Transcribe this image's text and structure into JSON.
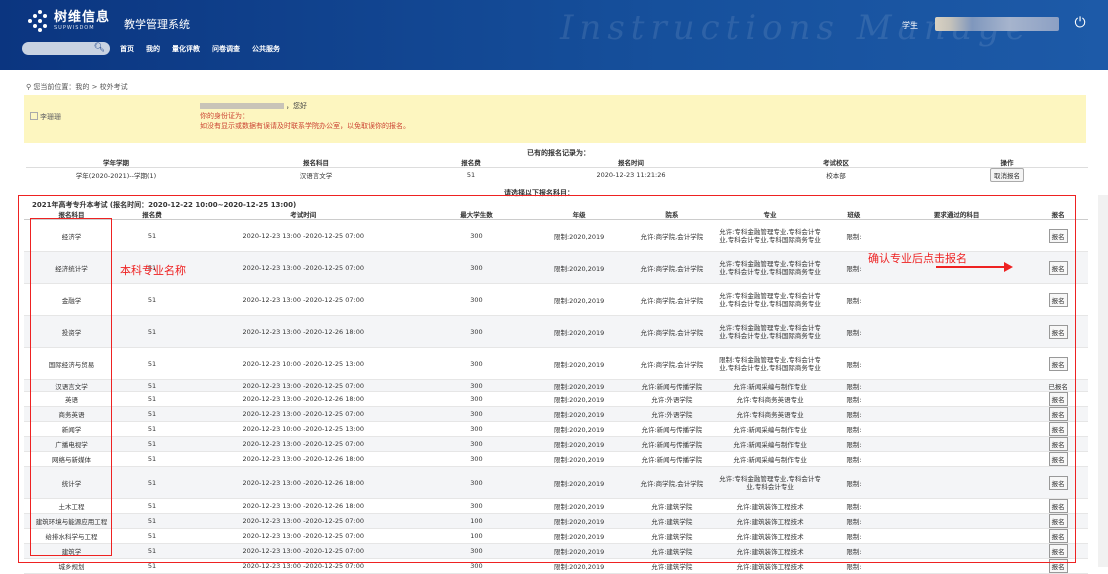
{
  "header": {
    "logo_cn": "树维信息",
    "logo_en": "SUPWISDOM",
    "system_title": "教学管理系统",
    "watermark": "Instructions Manage",
    "student_label": "学生"
  },
  "nav": {
    "items": [
      "首页",
      "我的",
      "量化评教",
      "问卷调查",
      "公共服务"
    ]
  },
  "breadcrumb": "您当前位置：我的 > 校外考试",
  "notice": {
    "image_alt": "李珊珊",
    "greeting": "，您好",
    "identity": "你的身份证为：",
    "hint": "如没有显示或数据有误请及时联系学院办公室，以免取误你的报名。"
  },
  "records": {
    "title": "已有的报名记录为：",
    "headers": [
      "学年学期",
      "报名科目",
      "报名费",
      "报名时间",
      "考试校区",
      "操作"
    ],
    "rows": [
      {
        "term": "学年(2020-2021)--学期(1)",
        "subject": "汉语言文学",
        "fee": "51",
        "time": "2020-12-23 11:21:26",
        "campus": "校本部",
        "action": "取消报名"
      }
    ]
  },
  "select_title": "请选择以下报名科目：",
  "exam": {
    "title": "2021年高考专升本考试 (报名时间：2020-12-22 10:00~2020-12-25 13:00)",
    "headers": [
      "报名科目",
      "报名费",
      "考试时间",
      "最大学生数",
      "年级",
      "院系",
      "专业",
      "班级",
      "要求通过的科目",
      "报名"
    ]
  },
  "rows": [
    {
      "subject": "经济学",
      "fee": "51",
      "time": "2020-12-23 13:00 -2020-12-25 07:00",
      "max": "300",
      "grade": "限制:2020,2019",
      "dept": "允许:商学院,会计学院",
      "major": "允许:专科金融管理专业,专科会计专业,专科会计专业,专科国际商务专业",
      "cls": "限制:",
      "action": "报名"
    },
    {
      "subject": "经济统计学",
      "fee": "51",
      "time": "2020-12-23 13:00 -2020-12-25 07:00",
      "max": "300",
      "grade": "限制:2020,2019",
      "dept": "允许:商学院,会计学院",
      "major": "允许:专科金融管理专业,专科会计专业,专科会计专业,专科国际商务专业",
      "cls": "限制:",
      "action": "报名"
    },
    {
      "subject": "金融学",
      "fee": "51",
      "time": "2020-12-23 13:00 -2020-12-25 07:00",
      "max": "300",
      "grade": "限制:2020,2019",
      "dept": "允许:商学院,会计学院",
      "major": "允许:专科金融管理专业,专科会计专业,专科会计专业,专科国际商务专业",
      "cls": "限制:",
      "action": "报名"
    },
    {
      "subject": "投资学",
      "fee": "51",
      "time": "2020-12-23 13:00 -2020-12-26 18:00",
      "max": "300",
      "grade": "限制:2020,2019",
      "dept": "允许:商学院,会计学院",
      "major": "允许:专科金融管理专业,专科会计专业,专科会计专业,专科国际商务专业",
      "cls": "限制:",
      "action": "报名"
    },
    {
      "subject": "国际经济与贸易",
      "fee": "51",
      "time": "2020-12-23 10:00 -2020-12-25 13:00",
      "max": "300",
      "grade": "限制:2020,2019",
      "dept": "允许:商学院,会计学院",
      "major": "限制:专科金融管理专业,专科会计专业,专科会计专业,专科国际商务专业",
      "cls": "限制:",
      "action": "报名"
    },
    {
      "subject": "汉语言文学",
      "fee": "51",
      "time": "2020-12-23 13:00 -2020-12-25 07:00",
      "max": "300",
      "grade": "限制:2020,2019",
      "dept": "允许:新闻与传播学院",
      "major": "允许:新闻采编与制作专业",
      "cls": "限制:",
      "action": "已报名"
    },
    {
      "subject": "英语",
      "fee": "51",
      "time": "2020-12-23 13:00 -2020-12-26 18:00",
      "max": "300",
      "grade": "限制:2020,2019",
      "dept": "允许:外语学院",
      "major": "允许:专科商务英语专业",
      "cls": "限制:",
      "action": "报名"
    },
    {
      "subject": "商务英语",
      "fee": "51",
      "time": "2020-12-23 13:00 -2020-12-25 07:00",
      "max": "300",
      "grade": "限制:2020,2019",
      "dept": "允许:外语学院",
      "major": "允许:专科商务英语专业",
      "cls": "限制:",
      "action": "报名"
    },
    {
      "subject": "新闻学",
      "fee": "51",
      "time": "2020-12-23 10:00 -2020-12-25 13:00",
      "max": "300",
      "grade": "限制:2020,2019",
      "dept": "允许:新闻与传播学院",
      "major": "允许:新闻采编与制作专业",
      "cls": "限制:",
      "action": "报名"
    },
    {
      "subject": "广播电视学",
      "fee": "51",
      "time": "2020-12-23 13:00 -2020-12-25 07:00",
      "max": "300",
      "grade": "限制:2020,2019",
      "dept": "允许:新闻与传播学院",
      "major": "允许:新闻采编与制作专业",
      "cls": "限制:",
      "action": "报名"
    },
    {
      "subject": "网络与新媒体",
      "fee": "51",
      "time": "2020-12-23 13:00 -2020-12-26 18:00",
      "max": "300",
      "grade": "限制:2020,2019",
      "dept": "允许:新闻与传播学院",
      "major": "允许:新闻采编与制作专业",
      "cls": "限制:",
      "action": "报名"
    },
    {
      "subject": "统计学",
      "fee": "51",
      "time": "2020-12-23 13:00 -2020-12-26 18:00",
      "max": "300",
      "grade": "限制:2020,2019",
      "dept": "允许:商学院,会计学院",
      "major": "允许:专科金融管理专业,专科会计专业,专科会计专业",
      "cls": "限制:",
      "action": "报名"
    },
    {
      "subject": "土木工程",
      "fee": "51",
      "time": "2020-12-23 13:00 -2020-12-26 18:00",
      "max": "300",
      "grade": "限制:2020,2019",
      "dept": "允许:建筑学院",
      "major": "允许:建筑装饰工程技术",
      "cls": "限制:",
      "action": "报名"
    },
    {
      "subject": "建筑环境与能源应用工程",
      "fee": "51",
      "time": "2020-12-23 13:00 -2020-12-25 07:00",
      "max": "100",
      "grade": "限制:2020,2019",
      "dept": "允许:建筑学院",
      "major": "允许:建筑装饰工程技术",
      "cls": "限制:",
      "action": "报名"
    },
    {
      "subject": "给排水科学与工程",
      "fee": "51",
      "time": "2020-12-23 13:00 -2020-12-25 07:00",
      "max": "100",
      "grade": "限制:2020,2019",
      "dept": "允许:建筑学院",
      "major": "允许:建筑装饰工程技术",
      "cls": "限制:",
      "action": "报名"
    },
    {
      "subject": "建筑学",
      "fee": "51",
      "time": "2020-12-23 13:00 -2020-12-25 07:00",
      "max": "300",
      "grade": "限制:2020,2019",
      "dept": "允许:建筑学院",
      "major": "允许:建筑装饰工程技术",
      "cls": "限制:",
      "action": "报名"
    },
    {
      "subject": "城乡规划",
      "fee": "51",
      "time": "2020-12-23 13:00 -2020-12-25 07:00",
      "max": "300",
      "grade": "限制:2020,2019",
      "dept": "允许:建筑学院",
      "major": "允许:建筑装饰工程技术",
      "cls": "限制:",
      "action": "报名"
    }
  ],
  "annotations": {
    "left_label": "本科专业名称",
    "right_label": "确认专业后点击报名"
  },
  "colors": {
    "header_bg": "#0f3f88",
    "notice_bg": "#fdf6c0",
    "annotation_red": "#e22222"
  }
}
